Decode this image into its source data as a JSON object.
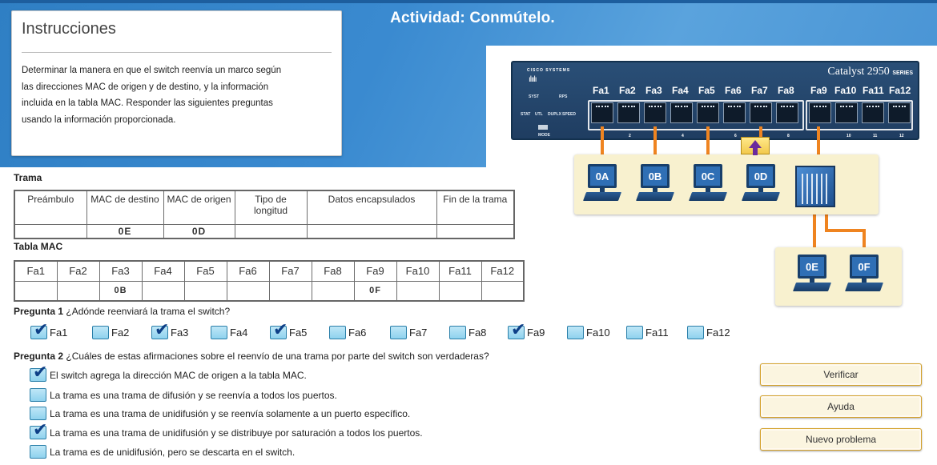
{
  "title": "Actividad: Conmútelo.",
  "instructions": {
    "heading": "Instrucciones",
    "lines": [
      "Determinar la manera en que el switch reenvía un marco según",
      "las direcciones MAC de origen y de destino, y la información",
      "incluida en la tabla MAC. Responder las siguientes preguntas",
      "usando la información proporcionada."
    ]
  },
  "frame": {
    "label": "Trama",
    "headers": [
      "Preámbulo",
      "MAC de destino",
      "MAC de origen",
      "Tipo de longitud",
      "Datos encapsulados",
      "Fin de la trama"
    ],
    "values": [
      "",
      "0E",
      "0D",
      "",
      "",
      ""
    ]
  },
  "mac_table": {
    "label": "Tabla MAC",
    "headers": [
      "Fa1",
      "Fa2",
      "Fa3",
      "Fa4",
      "Fa5",
      "Fa6",
      "Fa7",
      "Fa8",
      "Fa9",
      "Fa10",
      "Fa11",
      "Fa12"
    ],
    "values": [
      "",
      "",
      "0B",
      "",
      "",
      "",
      "",
      "",
      "0F",
      "",
      "",
      ""
    ]
  },
  "question1": {
    "label": "Pregunta 1",
    "text": "¿Adónde reenviará la trama el switch?",
    "options": [
      {
        "label": "Fa1",
        "checked": true
      },
      {
        "label": "Fa2",
        "checked": false
      },
      {
        "label": "Fa3",
        "checked": true
      },
      {
        "label": "Fa4",
        "checked": false
      },
      {
        "label": "Fa5",
        "checked": true
      },
      {
        "label": "Fa6",
        "checked": false
      },
      {
        "label": "Fa7",
        "checked": false
      },
      {
        "label": "Fa8",
        "checked": false
      },
      {
        "label": "Fa9",
        "checked": true
      },
      {
        "label": "Fa10",
        "checked": false
      },
      {
        "label": "Fa11",
        "checked": false
      },
      {
        "label": "Fa12",
        "checked": false
      }
    ]
  },
  "question2": {
    "label": "Pregunta 2",
    "text": "¿Cuáles de estas afirmaciones sobre el reenvío de una trama por parte del switch son verdaderas?",
    "options": [
      {
        "label": "El switch agrega la dirección MAC de origen a la tabla MAC.",
        "checked": true
      },
      {
        "label": "La trama es una trama de difusión y se reenvía a todos los puertos.",
        "checked": false
      },
      {
        "label": "La trama es una trama de unidifusión y se reenvía solamente a un puerto específico.",
        "checked": false
      },
      {
        "label": "La trama es una trama de unidifusión y se distribuye por saturación a todos los puertos.",
        "checked": true
      },
      {
        "label": "La trama es de unidifusión, pero se descarta en el switch.",
        "checked": false
      }
    ]
  },
  "buttons": {
    "verify": "Verificar",
    "help": "Ayuda",
    "new_problem": "Nuevo problema"
  },
  "diagram": {
    "switch_brand": "Catalyst 2950",
    "switch_series": "SERIES",
    "vendor": "CISCO SYSTEMS",
    "led_labels": [
      "SYST",
      "RPS",
      "STAT",
      "UTL",
      "DUPLX",
      "SPEED",
      "MODE"
    ],
    "ports": [
      "Fa1",
      "Fa2",
      "Fa3",
      "Fa4",
      "Fa5",
      "Fa6",
      "Fa7",
      "Fa8",
      "Fa9",
      "Fa10",
      "Fa11",
      "Fa12"
    ],
    "port_numbers": [
      "2",
      "4",
      "6",
      "8",
      "10",
      "11",
      "12"
    ],
    "pcs_top": [
      "0A",
      "0B",
      "0C",
      "0D"
    ],
    "pcs_bottom": [
      "0E",
      "0F"
    ],
    "colors": {
      "cable": "#ef8420",
      "frame_arrow": "#6a2b9d",
      "pc_area": "#f8f1cf"
    }
  }
}
